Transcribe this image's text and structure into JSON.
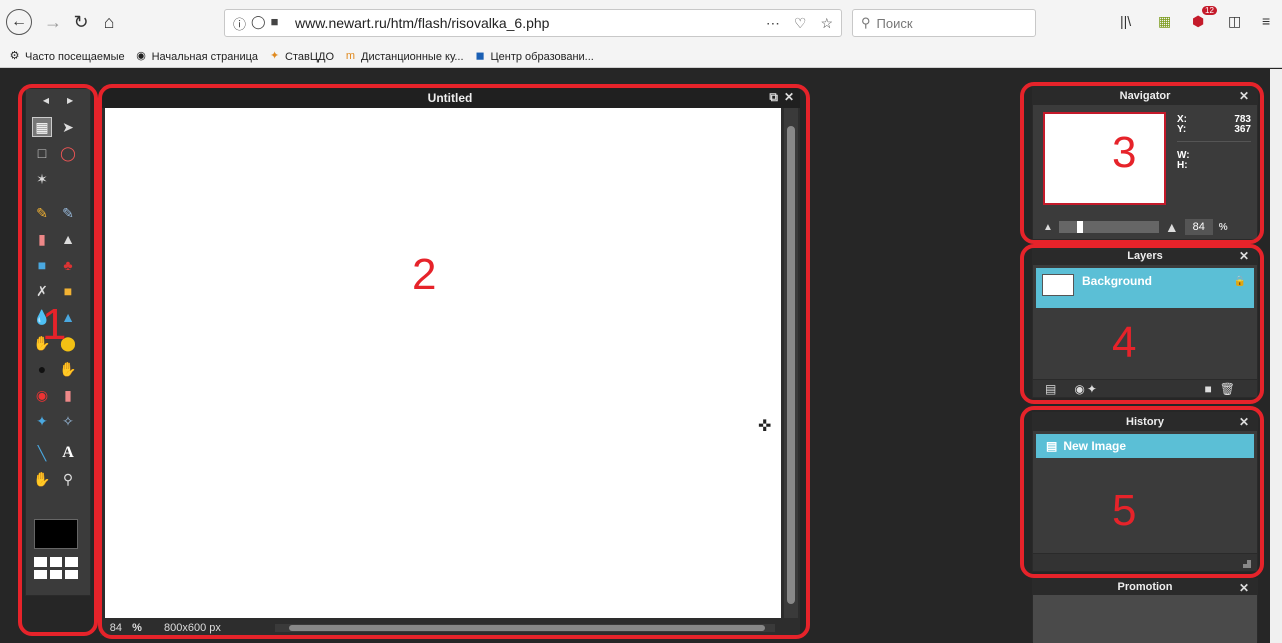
{
  "browser": {
    "url": "www.newart.ru/htm/flash/risovalka_6.php",
    "search_placeholder": "Поиск",
    "badge_count": "12",
    "bookmarks": [
      {
        "label": "Часто посещаемые",
        "icon": "gear-icon"
      },
      {
        "label": "Начальная страница",
        "icon": "globe-icon"
      },
      {
        "label": "СтавЦДО",
        "icon": "star-icon"
      },
      {
        "label": "Дистанционные ку...",
        "icon": "moodle-icon"
      },
      {
        "label": "Центр образовани...",
        "icon": "shield-icon"
      }
    ]
  },
  "canvas": {
    "title": "Untitled",
    "zoom": "84",
    "zoom_unit": "%",
    "size": "800x600 px"
  },
  "navigator": {
    "title": "Navigator",
    "x_label": "X:",
    "x_value": "783",
    "y_label": "Y:",
    "y_value": "367",
    "w_label": "W:",
    "h_label": "H:",
    "zoom": "84",
    "zoom_unit": "%"
  },
  "layers": {
    "title": "Layers",
    "items": [
      {
        "name": "Background"
      }
    ]
  },
  "history": {
    "title": "History",
    "items": [
      {
        "name": "New Image"
      }
    ]
  },
  "promotion": {
    "title": "Promotion"
  },
  "annotations": [
    "1",
    "2",
    "3",
    "4",
    "5"
  ],
  "colors": {
    "annotation_red": "#e6232a",
    "selection_blue": "#5bbfd6",
    "panel_bg": "#3b3b3b"
  }
}
